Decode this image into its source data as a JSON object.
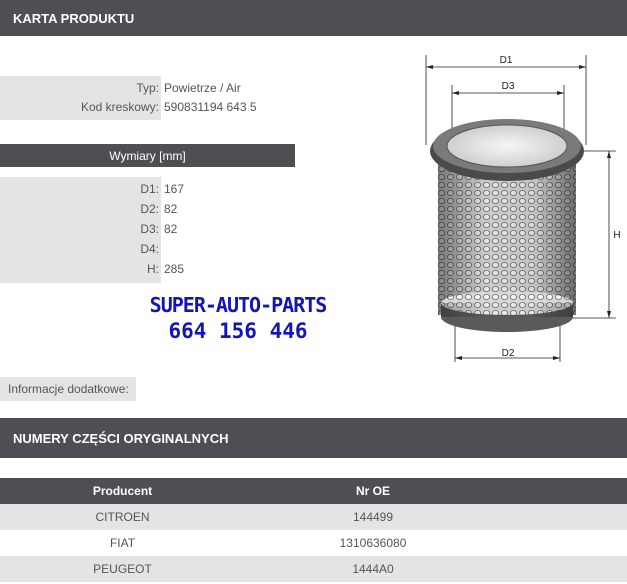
{
  "header": {
    "title": "KARTA PRODUKTU"
  },
  "product": {
    "type_label": "Typ:",
    "type_value": "Powietrze / Air",
    "barcode_label": "Kod kreskowy:",
    "barcode_value": "590831194 643 5"
  },
  "dimensions": {
    "title": "Wymiary [mm]",
    "rows": [
      {
        "label": "D1:",
        "value": "167"
      },
      {
        "label": "D2:",
        "value": "82"
      },
      {
        "label": "D3:",
        "value": "82"
      },
      {
        "label": "D4:",
        "value": ""
      },
      {
        "label": "H:",
        "value": "285"
      }
    ]
  },
  "promo": {
    "line1": "SUPER-AUTO-PARTS",
    "line2": "664 156 446"
  },
  "extra": {
    "label": "Informacje dodatkowe:"
  },
  "oe_section": {
    "title": "NUMERY CZĘŚCI ORYGINALNYCH",
    "columns": [
      "Producent",
      "Nr OE"
    ],
    "rows": [
      {
        "producer": "CITROEN",
        "number": "144499"
      },
      {
        "producer": "FIAT",
        "number": "1310636080"
      },
      {
        "producer": "PEUGEOT",
        "number": "1444A0"
      }
    ]
  },
  "diagram": {
    "d1": "D1",
    "d2": "D2",
    "d3": "D3",
    "h": "H"
  },
  "colors": {
    "header_bg": "#4d4f52",
    "label_bg": "#e4e4e6",
    "promo": "#1414b8"
  }
}
